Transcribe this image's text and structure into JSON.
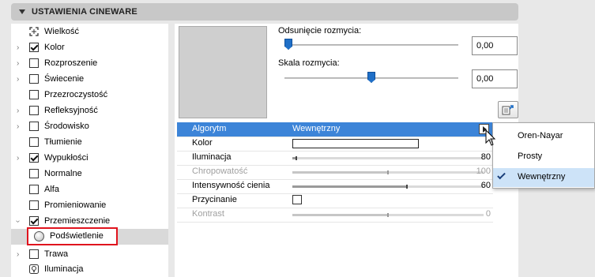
{
  "header": {
    "title": "USTAWIENIA CINEWARE"
  },
  "tree": {
    "items": [
      {
        "label": "Wielkość",
        "arrow": false,
        "checkbox": null,
        "icon": "resize-icon"
      },
      {
        "label": "Kolor",
        "arrow": true,
        "checkbox": true
      },
      {
        "label": "Rozproszenie",
        "arrow": true,
        "checkbox": false
      },
      {
        "label": "Świecenie",
        "arrow": true,
        "checkbox": false
      },
      {
        "label": "Przezroczystość",
        "arrow": false,
        "checkbox": false
      },
      {
        "label": "Refleksyjność",
        "arrow": true,
        "checkbox": false
      },
      {
        "label": "Środowisko",
        "arrow": true,
        "checkbox": false
      },
      {
        "label": "Tłumienie",
        "arrow": false,
        "checkbox": false
      },
      {
        "label": "Wypukłości",
        "arrow": true,
        "checkbox": true
      },
      {
        "label": "Normalne",
        "arrow": false,
        "checkbox": false
      },
      {
        "label": "Alfa",
        "arrow": false,
        "checkbox": false
      },
      {
        "label": "Promieniowanie",
        "arrow": false,
        "checkbox": false
      },
      {
        "label": "Przemieszczenie",
        "arrow": true,
        "checkbox": true
      },
      {
        "label": "Podświetlenie",
        "selected": true,
        "icon": "sphere-icon"
      },
      {
        "label": "Trawa",
        "arrow": true,
        "checkbox": false
      },
      {
        "label": "Iluminacja",
        "arrow": false,
        "checkbox": null,
        "icon": "bulb-icon"
      }
    ]
  },
  "sliders": {
    "blur_offset": {
      "label": "Odsunięcie rozmycia:",
      "value": "0,00",
      "level": 0.0
    },
    "blur_scale": {
      "label": "Skala rozmycia:",
      "value": "0,00",
      "level": 0.5
    }
  },
  "params": {
    "algorithm": {
      "label": "Algorytm",
      "value": "Wewnętrzny"
    },
    "color": {
      "label": "Kolor",
      "swatch": "#ffffff"
    },
    "illumination": {
      "label": "Iluminacja",
      "value": "80",
      "level": 0.02
    },
    "roughness": {
      "label": "Chropowatość",
      "value": "100",
      "level": 0.5,
      "disabled": true
    },
    "shadow": {
      "label": "Intensywność cienia",
      "value": "60",
      "level": 0.6
    },
    "clipping": {
      "label": "Przycinanie",
      "checked": false
    },
    "contrast": {
      "label": "Kontrast",
      "value": "0",
      "level": 0.5,
      "disabled": true
    }
  },
  "dropdown": {
    "options": [
      {
        "label": "Oren-Nayar",
        "selected": false
      },
      {
        "label": "Prosty",
        "selected": false
      },
      {
        "label": "Wewnętrzny",
        "selected": true
      }
    ]
  },
  "colors": {
    "accent": "#3c84d8",
    "highlight_border": "#e0141e"
  }
}
